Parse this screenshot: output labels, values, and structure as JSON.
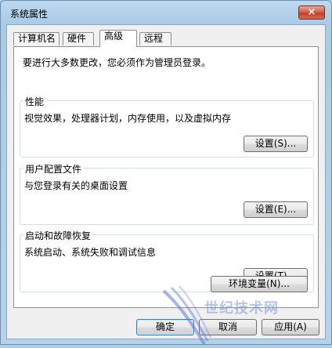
{
  "window": {
    "title": "系统属性",
    "close_label": "×"
  },
  "tabs": [
    {
      "label": "计算机名",
      "active": false
    },
    {
      "label": "硬件",
      "active": false
    },
    {
      "label": "高级",
      "active": true
    },
    {
      "label": "远程",
      "active": false
    }
  ],
  "advanced": {
    "intro": "要进行大多数更改，您必须作为管理员登录。",
    "performance": {
      "title": "性能",
      "description": "视觉效果，处理器计划，内存使用，以及虚拟内存",
      "button": "设置(S)..."
    },
    "user_profiles": {
      "title": "用户配置文件",
      "description": "与您登录有关的桌面设置",
      "button": "设置(E)..."
    },
    "startup_recovery": {
      "title": "启动和故障恢复",
      "description": "系统启动、系统失败和调试信息",
      "button": "设置(T)..."
    },
    "env_button": "环境变量(N)..."
  },
  "footer": {
    "ok": "确定",
    "cancel": "取消",
    "apply": "应用(A)"
  },
  "watermark": {
    "text": "世纪技术网"
  },
  "colors": {
    "accent": "#3c7fb1",
    "close": "#c4402a"
  }
}
